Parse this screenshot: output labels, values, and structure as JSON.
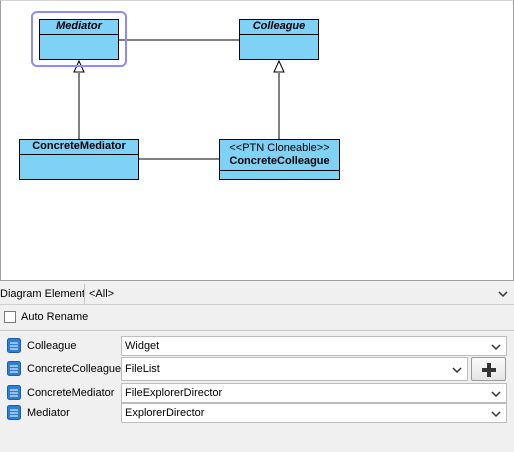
{
  "diagram": {
    "classes": {
      "mediator": {
        "name": "Mediator"
      },
      "colleague": {
        "name": "Colleague"
      },
      "concrete_mediator": {
        "name": "ConcreteMediator"
      },
      "concrete_colleague": {
        "stereotype": "<<PTN Cloneable>>",
        "name": "ConcreteColleague"
      }
    }
  },
  "element_filter": {
    "label": "Diagram Element",
    "value": "<All>"
  },
  "auto_rename": {
    "label": "Auto Rename",
    "checked": false
  },
  "properties": [
    {
      "label": "Colleague",
      "value": "Widget",
      "icon": "class-icon"
    },
    {
      "label": "ConcreteColleague",
      "value": "FileList",
      "icon": "class-icon",
      "add_button": "plus-icon"
    },
    {
      "label": "ConcreteMediator",
      "value": "FileExplorerDirector",
      "icon": "class-icon"
    },
    {
      "label": "Mediator",
      "value": "ExplorerDirector",
      "icon": "class-icon"
    }
  ],
  "colors": {
    "class_fill": "#7fd1f5",
    "selection": "#8c8cf2",
    "icon_blue": "#2d7fd6"
  }
}
